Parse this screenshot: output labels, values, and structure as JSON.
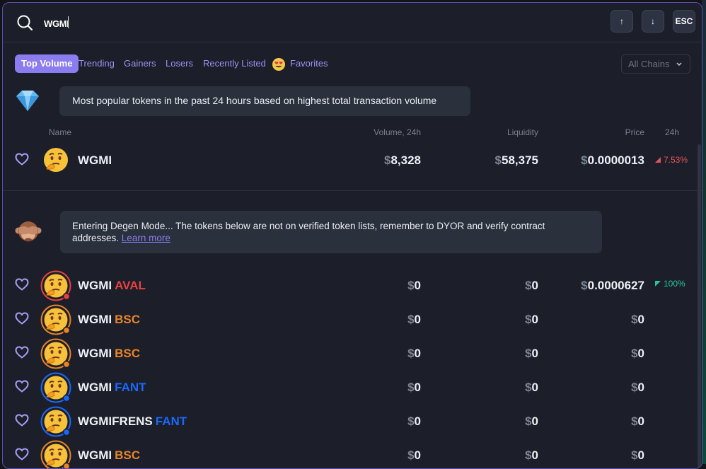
{
  "search": {
    "value": "WGMI",
    "placeholder": ""
  },
  "keys": {
    "up": "↑",
    "down": "↓",
    "esc": "ESC"
  },
  "tabs": [
    {
      "label": "Top Volume",
      "active": true
    },
    {
      "label": "Trending"
    },
    {
      "label": "Gainers"
    },
    {
      "label": "Losers"
    },
    {
      "label": "Recently Listed"
    },
    {
      "label": "Favorites"
    }
  ],
  "chains_filter": {
    "value": "All Chains"
  },
  "top_banner": {
    "text": "Most popular tokens in the past 24 hours based on highest total transaction volume",
    "icon": "diamond-icon"
  },
  "columns": {
    "name": "Name",
    "volume": "Volume, 24h",
    "liquidity": "Liquidity",
    "price": "Price",
    "change": "24h"
  },
  "currency_symbol": "$",
  "verified_tokens": [
    {
      "name": "WGMI",
      "chain": "",
      "volume": "8,328",
      "liquidity": "58,375",
      "price": "0.0000013",
      "change": "7.53%",
      "direction": "down"
    }
  ],
  "degen_banner": {
    "text": "Entering Degen Mode... The tokens below are not on verified token lists, remember to DYOR and verify contract addresses. ",
    "link": "Learn more",
    "icon": "see-no-evil-monkey-icon"
  },
  "degen_tokens": [
    {
      "name": "WGMI",
      "chain": "AVAL",
      "chain_color": "#e84142",
      "volume": "0",
      "liquidity": "0",
      "price": "0.0000627",
      "change": "100%",
      "direction": "up"
    },
    {
      "name": "WGMI",
      "chain": "BSC",
      "chain_color": "#e8832a",
      "volume": "0",
      "liquidity": "0",
      "price": "0",
      "change": ""
    },
    {
      "name": "WGMI",
      "chain": "BSC",
      "chain_color": "#e8832a",
      "volume": "0",
      "liquidity": "0",
      "price": "0",
      "change": ""
    },
    {
      "name": "WGMI",
      "chain": "FANT",
      "chain_color": "#1969ff",
      "volume": "0",
      "liquidity": "0",
      "price": "0",
      "change": ""
    },
    {
      "name": "WGMIFRENS",
      "chain": "FANT",
      "chain_color": "#1969ff",
      "volume": "0",
      "liquidity": "0",
      "price": "0",
      "change": ""
    },
    {
      "name": "WGMI",
      "chain": "BSC",
      "chain_color": "#e8832a",
      "volume": "0",
      "liquidity": "0",
      "price": "0",
      "change": ""
    }
  ],
  "colors": {
    "accent": "#8b7cf0",
    "up": "#27c79a",
    "down": "#e0545f"
  }
}
